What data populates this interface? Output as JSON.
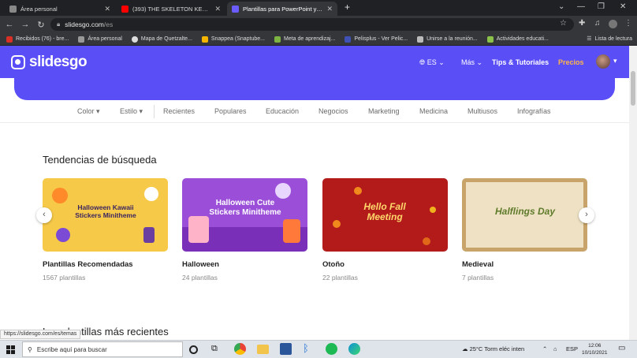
{
  "browser": {
    "tabs": [
      {
        "title": "Área personal",
        "color": "#888888"
      },
      {
        "title": "(393) THE SKELETON KEY | El",
        "color": "#ff0000"
      },
      {
        "title": "Plantillas para PowerPoint y Goo",
        "color": "#6a5cff"
      }
    ],
    "new_tab": "+",
    "url_host": "slidesgo.com",
    "url_path": "/es",
    "bookmarks": [
      {
        "label": "Recibidos (76) - bre...",
        "color": "#d93025"
      },
      {
        "label": "Área personal",
        "color": "#999999"
      },
      {
        "label": "Mapa de Quetzalte...",
        "color": "#dddddd"
      },
      {
        "label": "Snappea (Snaptube...",
        "color": "#f4b400"
      },
      {
        "label": "Meta de aprendizaj...",
        "color": "#7cb342"
      },
      {
        "label": "Pelisplus - Ver Pelic...",
        "color": "#3f51b5"
      },
      {
        "label": "Unirse a la reunión...",
        "color": "#bbbbbb"
      },
      {
        "label": "Actividades educati...",
        "color": "#8bc34a"
      }
    ],
    "reading_list": "Lista de lectura"
  },
  "site": {
    "logo": "slidesgo",
    "lang": "ES",
    "more": "Más",
    "tips": "Tips & Tutoriales",
    "pricing": "Precios",
    "filters": [
      "Color",
      "Estilo",
      "Recientes",
      "Populares",
      "Educación",
      "Negocios",
      "Marketing",
      "Medicina",
      "Multiusos",
      "Infografías"
    ],
    "section_title": "Tendencias de búsqueda",
    "cards": [
      {
        "title": "Plantillas Recomendadas",
        "count": "1567 plantillas",
        "thumb_title": "Halloween Kawaii Stickers Minitheme",
        "bg": "#f7c948"
      },
      {
        "title": "Halloween",
        "count": "24 plantillas",
        "thumb_title": "Halloween Cute Stickers Minitheme",
        "bg": "#9b4fd8"
      },
      {
        "title": "Otoño",
        "count": "22 plantillas",
        "thumb_title": "Hello Fall Meeting",
        "bg": "#b31b1b"
      },
      {
        "title": "Medieval",
        "count": "7 plantillas",
        "thumb_title": "Halflings Day",
        "bg": "#efe2c4"
      }
    ],
    "section2_title": "Las plantillas más recientes",
    "status_url": "https://slidesgo.com/es/temas"
  },
  "taskbar": {
    "search_placeholder": "Escribe aquí para buscar",
    "weather": "25°C  Torm eléc inten",
    "lang": "ESP",
    "time": "12:06",
    "date": "10/10/2021"
  }
}
